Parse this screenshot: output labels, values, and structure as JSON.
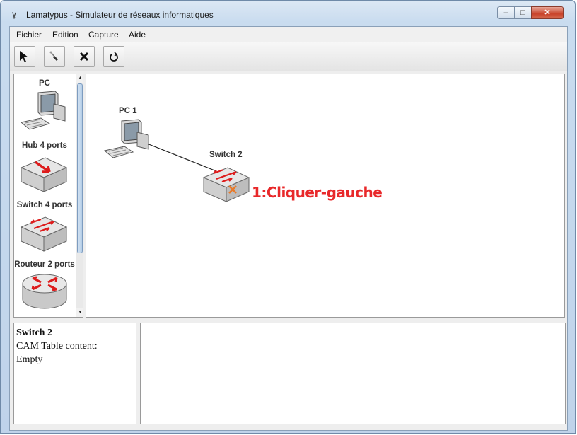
{
  "window": {
    "title": "Lamatypus - Simulateur de réseaux informatiques",
    "app_icon": "lamatypus-icon",
    "controls": {
      "minimize": "–",
      "maximize": "□",
      "close": "✕"
    }
  },
  "menu": [
    {
      "label": "Fichier"
    },
    {
      "label": "Edition"
    },
    {
      "label": "Capture"
    },
    {
      "label": "Aide"
    }
  ],
  "toolbar": [
    {
      "name": "select-tool",
      "icon": "arrow-cursor-icon"
    },
    {
      "name": "cable-tool",
      "icon": "cable-connect-icon"
    },
    {
      "name": "delete-tool",
      "icon": "delete-x-icon"
    },
    {
      "name": "reset-tool",
      "icon": "refresh-icon"
    }
  ],
  "palette": {
    "items": [
      {
        "label": "PC",
        "icon": "pc-icon"
      },
      {
        "label": "Hub 4 ports",
        "icon": "hub-icon"
      },
      {
        "label": "Switch 4 ports",
        "icon": "switch-icon"
      },
      {
        "label": "Routeur 2 ports",
        "icon": "router-icon"
      }
    ]
  },
  "canvas": {
    "nodes": [
      {
        "label": "PC 1",
        "icon": "pc-icon"
      },
      {
        "label": "Switch 2",
        "icon": "switch-icon"
      }
    ],
    "annotation": "1:Cliquer-gauche"
  },
  "info": {
    "title": "Switch 2",
    "line1": "CAM Table content:",
    "line2": "Empty"
  },
  "colors": {
    "annotation": "#e8282a",
    "device_arrows": "#dd1c1c"
  }
}
